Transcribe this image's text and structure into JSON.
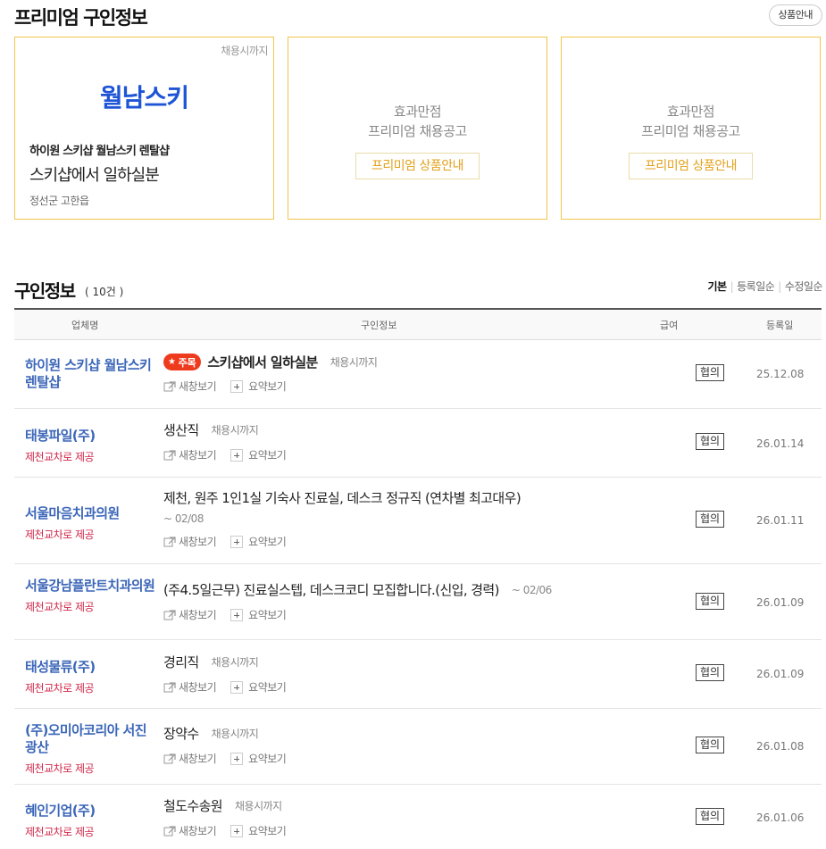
{
  "premium": {
    "title": "프리미엄 구인정보",
    "guide_button": "상품안내",
    "featured": {
      "deadline": "채용시까지",
      "logo_text": "월남스키",
      "company": "하이원 스키샵 월남스키 렌탈샵",
      "job": "스키샵에서 일하실분",
      "location": "정선군 고한읍"
    },
    "empty_slots": [
      {
        "line1": "효과만점",
        "line2": "프리미엄 채용공고",
        "button": "프리미엄 상품안내"
      },
      {
        "line1": "효과만점",
        "line2": "프리미엄 채용공고",
        "button": "프리미엄 상품안내"
      }
    ]
  },
  "list": {
    "title": "구인정보",
    "count": "( 10건 )",
    "sort": [
      "기본",
      "등록일순",
      "수정일순"
    ],
    "columns": {
      "company": "업체명",
      "info": "구인정보",
      "pay": "급여",
      "date": "등록일"
    },
    "actions": {
      "new_window": "새창보기",
      "summary": "요약보기"
    },
    "rows": [
      {
        "company": "하이원 스키샵 월남스키 렌탈샵",
        "badge": "주목",
        "transport": "",
        "job": "스키샵에서 일하실분",
        "deadline": "채용시까지",
        "pay": "협의",
        "date": "25.12.08"
      },
      {
        "company": "태봉파일(주)",
        "badge": "",
        "transport": "제천교차로 제공",
        "job": "생산직",
        "deadline": "채용시까지",
        "pay": "협의",
        "date": "26.01.14"
      },
      {
        "company": "서울마음치과의원",
        "badge": "",
        "transport": "제천교차로 제공",
        "job": "제천, 원주 1인1실 기숙사 진료실, 데스크 정규직 (연차별 최고대우)",
        "deadline": "~ 02/08",
        "pay": "협의",
        "date": "26.01.11"
      },
      {
        "company": "서울강남플란트치과의원",
        "badge": "",
        "transport": "제천교차로 제공",
        "job": "(주4.5일근무) 진료실스텝, 데스크코디 모집합니다.(신입, 경력)",
        "deadline": "~ 02/06",
        "pay": "협의",
        "date": "26.01.09"
      },
      {
        "company": "태성물류(주)",
        "badge": "",
        "transport": "제천교차로 제공",
        "job": "경리직",
        "deadline": "채용시까지",
        "pay": "협의",
        "date": "26.01.09"
      },
      {
        "company": "(주)오미아코리아 서진광산",
        "badge": "",
        "transport": "제천교차로 제공",
        "job": "장약수",
        "deadline": "채용시까지",
        "pay": "협의",
        "date": "26.01.08"
      },
      {
        "company": "혜인기업(주)",
        "badge": "",
        "transport": "제천교차로 제공",
        "job": "철도수송원",
        "deadline": "채용시까지",
        "pay": "협의",
        "date": "26.01.06"
      }
    ]
  }
}
